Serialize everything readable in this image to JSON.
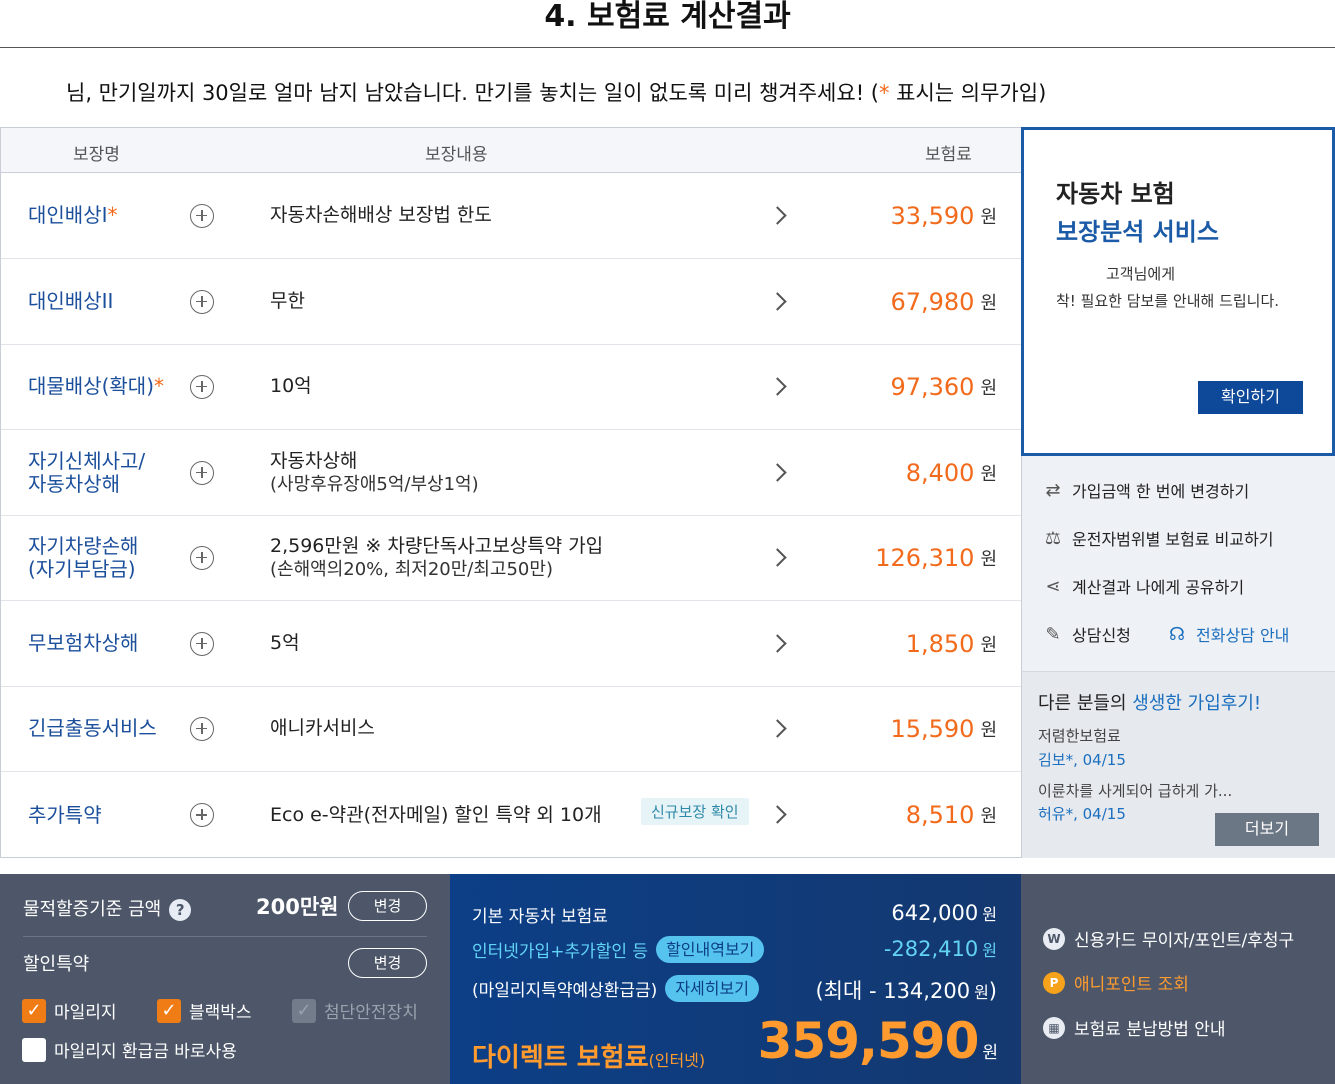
{
  "page_title": "4. 보험료 계산결과",
  "notice": {
    "text": "님, 만기일까지 30일로 얼마 남지 남았습니다. 만기를 놓치는 일이 없도록 미리 챙겨주세요! (",
    "star": "*",
    "suffix": " 표시는 의무가입)"
  },
  "table": {
    "headers": {
      "name": "보장명",
      "content": "보장내용",
      "premium": "보험료"
    },
    "unit": "원",
    "rows": [
      {
        "name": "대인배상I",
        "required": "*",
        "desc": "자동차손해배상 보장법 한도",
        "sub": "",
        "price": "33,590"
      },
      {
        "name": "대인배상II",
        "required": "",
        "desc": "무한",
        "sub": "",
        "price": "67,980"
      },
      {
        "name": "대물배상(확대)",
        "required": "*",
        "desc": "10억",
        "sub": "",
        "price": "97,360"
      },
      {
        "name": "자기신체사고/\n자동차상해",
        "required": "",
        "desc": "자동차상해",
        "sub": "(사망후유장애5억/부상1억)",
        "price": "8,400"
      },
      {
        "name": "자기차량손해\n(자기부담금)",
        "required": "",
        "desc": "2,596만원 ※ 차량단독사고보상특약 가입",
        "sub": "(손해액의20%, 최저20만/최고50만)",
        "price": "126,310"
      },
      {
        "name": "무보험차상해",
        "required": "",
        "desc": "5억",
        "sub": "",
        "price": "1,850"
      },
      {
        "name": "긴급출동서비스",
        "required": "",
        "desc": "애니카서비스",
        "sub": "",
        "price": "15,590"
      },
      {
        "name": "추가특약",
        "required": "",
        "desc": "Eco e-약관(전자메일) 할인 특약 외 10개",
        "sub": "",
        "price": "8,510",
        "badge": "신규보장 확인"
      }
    ]
  },
  "service": {
    "title1": "자동차 보험",
    "title2": "보장분석 서비스",
    "desc1": "고객님에게",
    "desc2": "착! 필요한 담보를 안내해 드립니다.",
    "button": "확인하기"
  },
  "menu": [
    {
      "icon": "shuffle-icon",
      "glyph": "⇄",
      "label": "가입금액 한 번에 변경하기"
    },
    {
      "icon": "scale-icon",
      "glyph": "⚖",
      "label": "운전자범위별 보험료 비교하기"
    },
    {
      "icon": "share-icon",
      "glyph": "⋖",
      "label": "계산결과 나에게 공유하기"
    },
    {
      "icon": "edit-icon",
      "glyph": "✎",
      "label": "상담신청"
    },
    {
      "icon": "headset-icon",
      "glyph": "☊",
      "label": "전화상담 안내"
    }
  ],
  "reviews": {
    "title_prefix": "다른 분들의 ",
    "title_highlight": "생생한 가입후기!",
    "items": [
      {
        "text": "저렴한보험료",
        "author": "김보*, 04/15"
      },
      {
        "text": "이륜차를 사게되어 급하게 가...",
        "author": "허유*, 04/15"
      }
    ],
    "more_button": "더보기"
  },
  "options": {
    "property_label": "물적할증기준 금액",
    "property_amount": "200만원",
    "change_label": "변경",
    "discount_label": "할인특약",
    "checks": [
      {
        "label": "마일리지",
        "state": "checked"
      },
      {
        "label": "블랙박스",
        "state": "checked"
      },
      {
        "label": "첨단안전장치",
        "state": "disabled"
      },
      {
        "label": "마일리지 환급금 바로사용",
        "state": "unchecked"
      }
    ]
  },
  "summary": {
    "base_label": "기본 자동차 보험료",
    "base_value": "642,000",
    "discount_label": "인터넷가입+추가할인 등",
    "discount_pill": "할인내역보기",
    "discount_value": "-282,410",
    "refund_label": "(마일리지특약예상환급금)",
    "refund_pill": "자세히보기",
    "refund_value": "(최대 - 134,200",
    "refund_close": ")",
    "unit": "원",
    "direct_label": "다이렉트 보험료",
    "direct_sub": "(인터넷)",
    "direct_total": "359,590"
  },
  "extra_links": [
    {
      "icon": "w-circle-icon",
      "glyph": "W",
      "label": "신용카드 무이자/포인트/후청구"
    },
    {
      "icon": "p-circle-icon",
      "glyph": "P",
      "label": "애니포인트 조회"
    },
    {
      "icon": "calendar-icon",
      "glyph": "▦",
      "label": "보험료 분납방법 안내"
    }
  ]
}
